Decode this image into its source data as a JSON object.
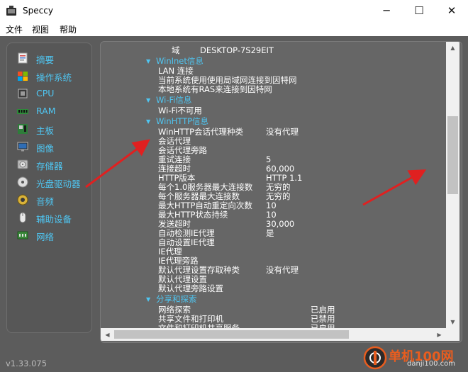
{
  "window": {
    "title": "Speccy",
    "minimize_glyph": "─",
    "maximize_glyph": "☐",
    "close_glyph": "✕"
  },
  "menu": {
    "file": "文件",
    "view": "视图",
    "help": "帮助"
  },
  "sidebar": {
    "items": [
      {
        "label": "摘要",
        "icon": "summary-icon"
      },
      {
        "label": "操作系统",
        "icon": "windows-icon"
      },
      {
        "label": "CPU",
        "icon": "cpu-icon"
      },
      {
        "label": "RAM",
        "icon": "ram-icon"
      },
      {
        "label": "主板",
        "icon": "motherboard-icon"
      },
      {
        "label": "图像",
        "icon": "monitor-icon"
      },
      {
        "label": "存储器",
        "icon": "hdd-icon"
      },
      {
        "label": "光盘驱动器",
        "icon": "optical-drive-icon"
      },
      {
        "label": "音频",
        "icon": "speaker-icon"
      },
      {
        "label": "辅助设备",
        "icon": "mouse-icon"
      },
      {
        "label": "网络",
        "icon": "network-icon"
      }
    ]
  },
  "version": "v1.33.075",
  "content": {
    "domain_row": {
      "key": "域",
      "value": "DESKTOP-7S29EIT"
    },
    "wininet": {
      "title": "WinInet信息",
      "lines": [
        "LAN 连接",
        "当前系统使用使用局域网连接到因特网",
        "本地系统有RAS来连接到因特网"
      ]
    },
    "wifi": {
      "title": "Wi-Fi信息",
      "lines": [
        "Wi-Fi不可用"
      ]
    },
    "winhttp": {
      "title": "WinHTTP信息",
      "rows": [
        {
          "key": "WinHTTP会话代理种类",
          "value": "没有代理"
        },
        {
          "key": "会话代理",
          "value": ""
        },
        {
          "key": "会话代理旁路",
          "value": ""
        },
        {
          "key": "重试连接",
          "value": "5"
        },
        {
          "key": "连接超时",
          "value": "60,000"
        },
        {
          "key": "HTTP版本",
          "value": "HTTP 1.1"
        },
        {
          "key": "每个1.0服务器最大连接数",
          "value": "无穷的"
        },
        {
          "key": "每个服务器最大连接数",
          "value": "无穷的"
        },
        {
          "key": "最大HTTP自动重定向次数",
          "value": "10"
        },
        {
          "key": "最大HTTP状态持续",
          "value": "10"
        },
        {
          "key": "发送超时",
          "value": "30,000"
        },
        {
          "key": "自动检测IE代理",
          "value": "是"
        },
        {
          "key": "自动设置IE代理",
          "value": ""
        },
        {
          "key": "IE代理",
          "value": ""
        },
        {
          "key": "IE代理旁路",
          "value": ""
        },
        {
          "key": "默认代理设置存取种类",
          "value": "没有代理"
        },
        {
          "key": "默认代理设置",
          "value": ""
        },
        {
          "key": "默认代理旁路设置",
          "value": ""
        }
      ]
    },
    "sharing": {
      "title": "分享和探索",
      "rows": [
        {
          "key": "网络探索",
          "value": "已启用"
        },
        {
          "key": "共享文件和打印机",
          "value": "已禁用"
        },
        {
          "key": "文件和打印机共享服务",
          "value": "已启用"
        }
      ]
    }
  },
  "watermark": {
    "text": "单机100网",
    "sub": "danji100.com"
  },
  "colors": {
    "accent": "#4fc6f2",
    "panel": "#666666",
    "background": "#5c5c5c",
    "arrow": "#e02020",
    "watermark": "#e85d1f"
  }
}
